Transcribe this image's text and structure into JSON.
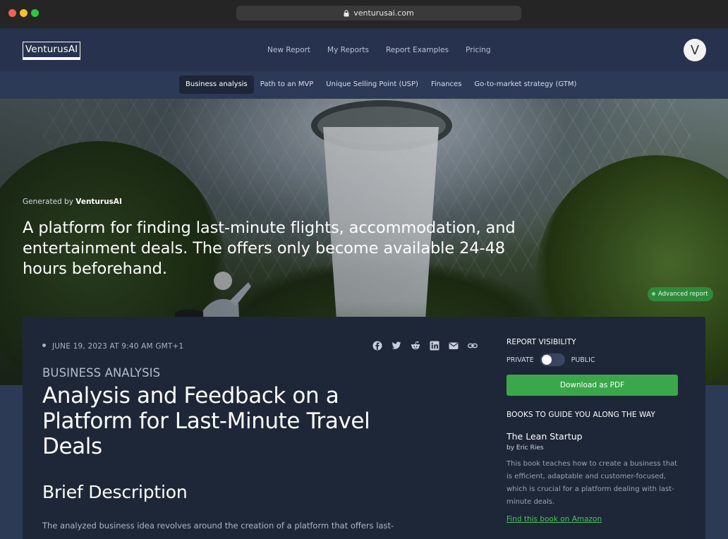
{
  "browser": {
    "url": "venturusai.com"
  },
  "nav": {
    "logo": "VenturusAI",
    "links": [
      "New Report",
      "My Reports",
      "Report Examples",
      "Pricing"
    ],
    "avatar_initial": "V"
  },
  "subnav": {
    "tabs": [
      "Business analysis",
      "Path to an MVP",
      "Unique Selling Point (USP)",
      "Finances",
      "Go-to-market strategy (GTM)"
    ],
    "active_index": 0
  },
  "hero": {
    "generated_prefix": "Generated by ",
    "generated_brand": "VenturusAI",
    "title": "A platform for finding last-minute flights, accommodation, and entertainment deals. The offers only become available 24-48 hours beforehand.",
    "badge": "Advanced report"
  },
  "report": {
    "date": "JUNE 19, 2023 AT 9:40 AM GMT+1",
    "share_icons": [
      "facebook-icon",
      "twitter-icon",
      "reddit-icon",
      "linkedin-icon",
      "email-icon",
      "link-icon"
    ],
    "kicker": "BUSINESS ANALYSIS",
    "title": "Analysis and Feedback on a Platform for Last-Minute Travel Deals",
    "section_heading": "Brief Description",
    "body": "The analyzed business idea revolves around the creation of a platform that offers last-"
  },
  "sidebar": {
    "visibility_label": "REPORT VISIBILITY",
    "private_label": "PRIVATE",
    "public_label": "PUBLIC",
    "visibility_is_public": false,
    "download_label": "Download as PDF",
    "books_label": "BOOKS TO GUIDE YOU ALONG THE WAY",
    "book": {
      "title": "The Lean Startup",
      "author": "by Eric Ries",
      "description": "This book teaches how to create a business that is efficient, adaptable and customer-focused, which is crucial for a platform dealing with last-minute deals.",
      "link": "Find this book on Amazon"
    }
  },
  "colors": {
    "nav_bg": "#27334e",
    "card_bg": "#1e2738",
    "accent_green": "#3aa84a",
    "link_green": "#4cc25c"
  }
}
